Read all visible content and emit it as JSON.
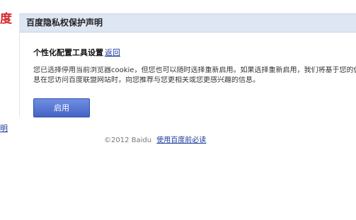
{
  "logo_fragment": "度",
  "header": {
    "title": "百度隐私权保护声明"
  },
  "sidebar": {
    "link_fragment": "明"
  },
  "section": {
    "title": "个性化配置工具设置",
    "back_link": "返回"
  },
  "description": {
    "line1": "您已选择停用当前浏览器cookie，但您也可以随时选择重新启用。如果选择重新启用，我们将基于您的偏",
    "line2": "息在您访问百度联盟网站时，向您推荐与您更相关或您更感兴趣的信息。"
  },
  "enable_button": {
    "label": "启用"
  },
  "footer": {
    "copyright": "©2012 Baidu",
    "terms_link": "使用百度前必读"
  },
  "colors": {
    "header_bg": "#dde6f2",
    "button_bg": "#4f6fd2",
    "link": "#1a3a9c",
    "brand_red": "#d8262e"
  }
}
